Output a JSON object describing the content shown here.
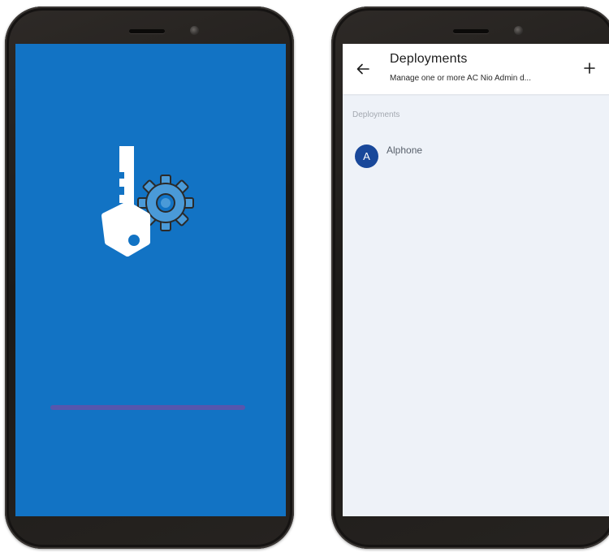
{
  "colors": {
    "splash_background": "#1273c4",
    "progress_bar": "#5656ad",
    "key_white": "#ffffff",
    "gear_blue": "#4a9ad8",
    "gear_outline": "#2a2a2a",
    "screen_background": "#eef2f8",
    "avatar_background": "#19489a"
  },
  "splash": {
    "logo_icon": "key-gear-icon"
  },
  "deployments": {
    "back_icon": "arrow-left-icon",
    "add_icon": "plus-icon",
    "title": "Deployments",
    "subtitle": "Manage one or more AC Nio Admin d...",
    "section_label": "Deployments",
    "items": [
      {
        "initial": "A",
        "label": "Alphone"
      }
    ]
  }
}
